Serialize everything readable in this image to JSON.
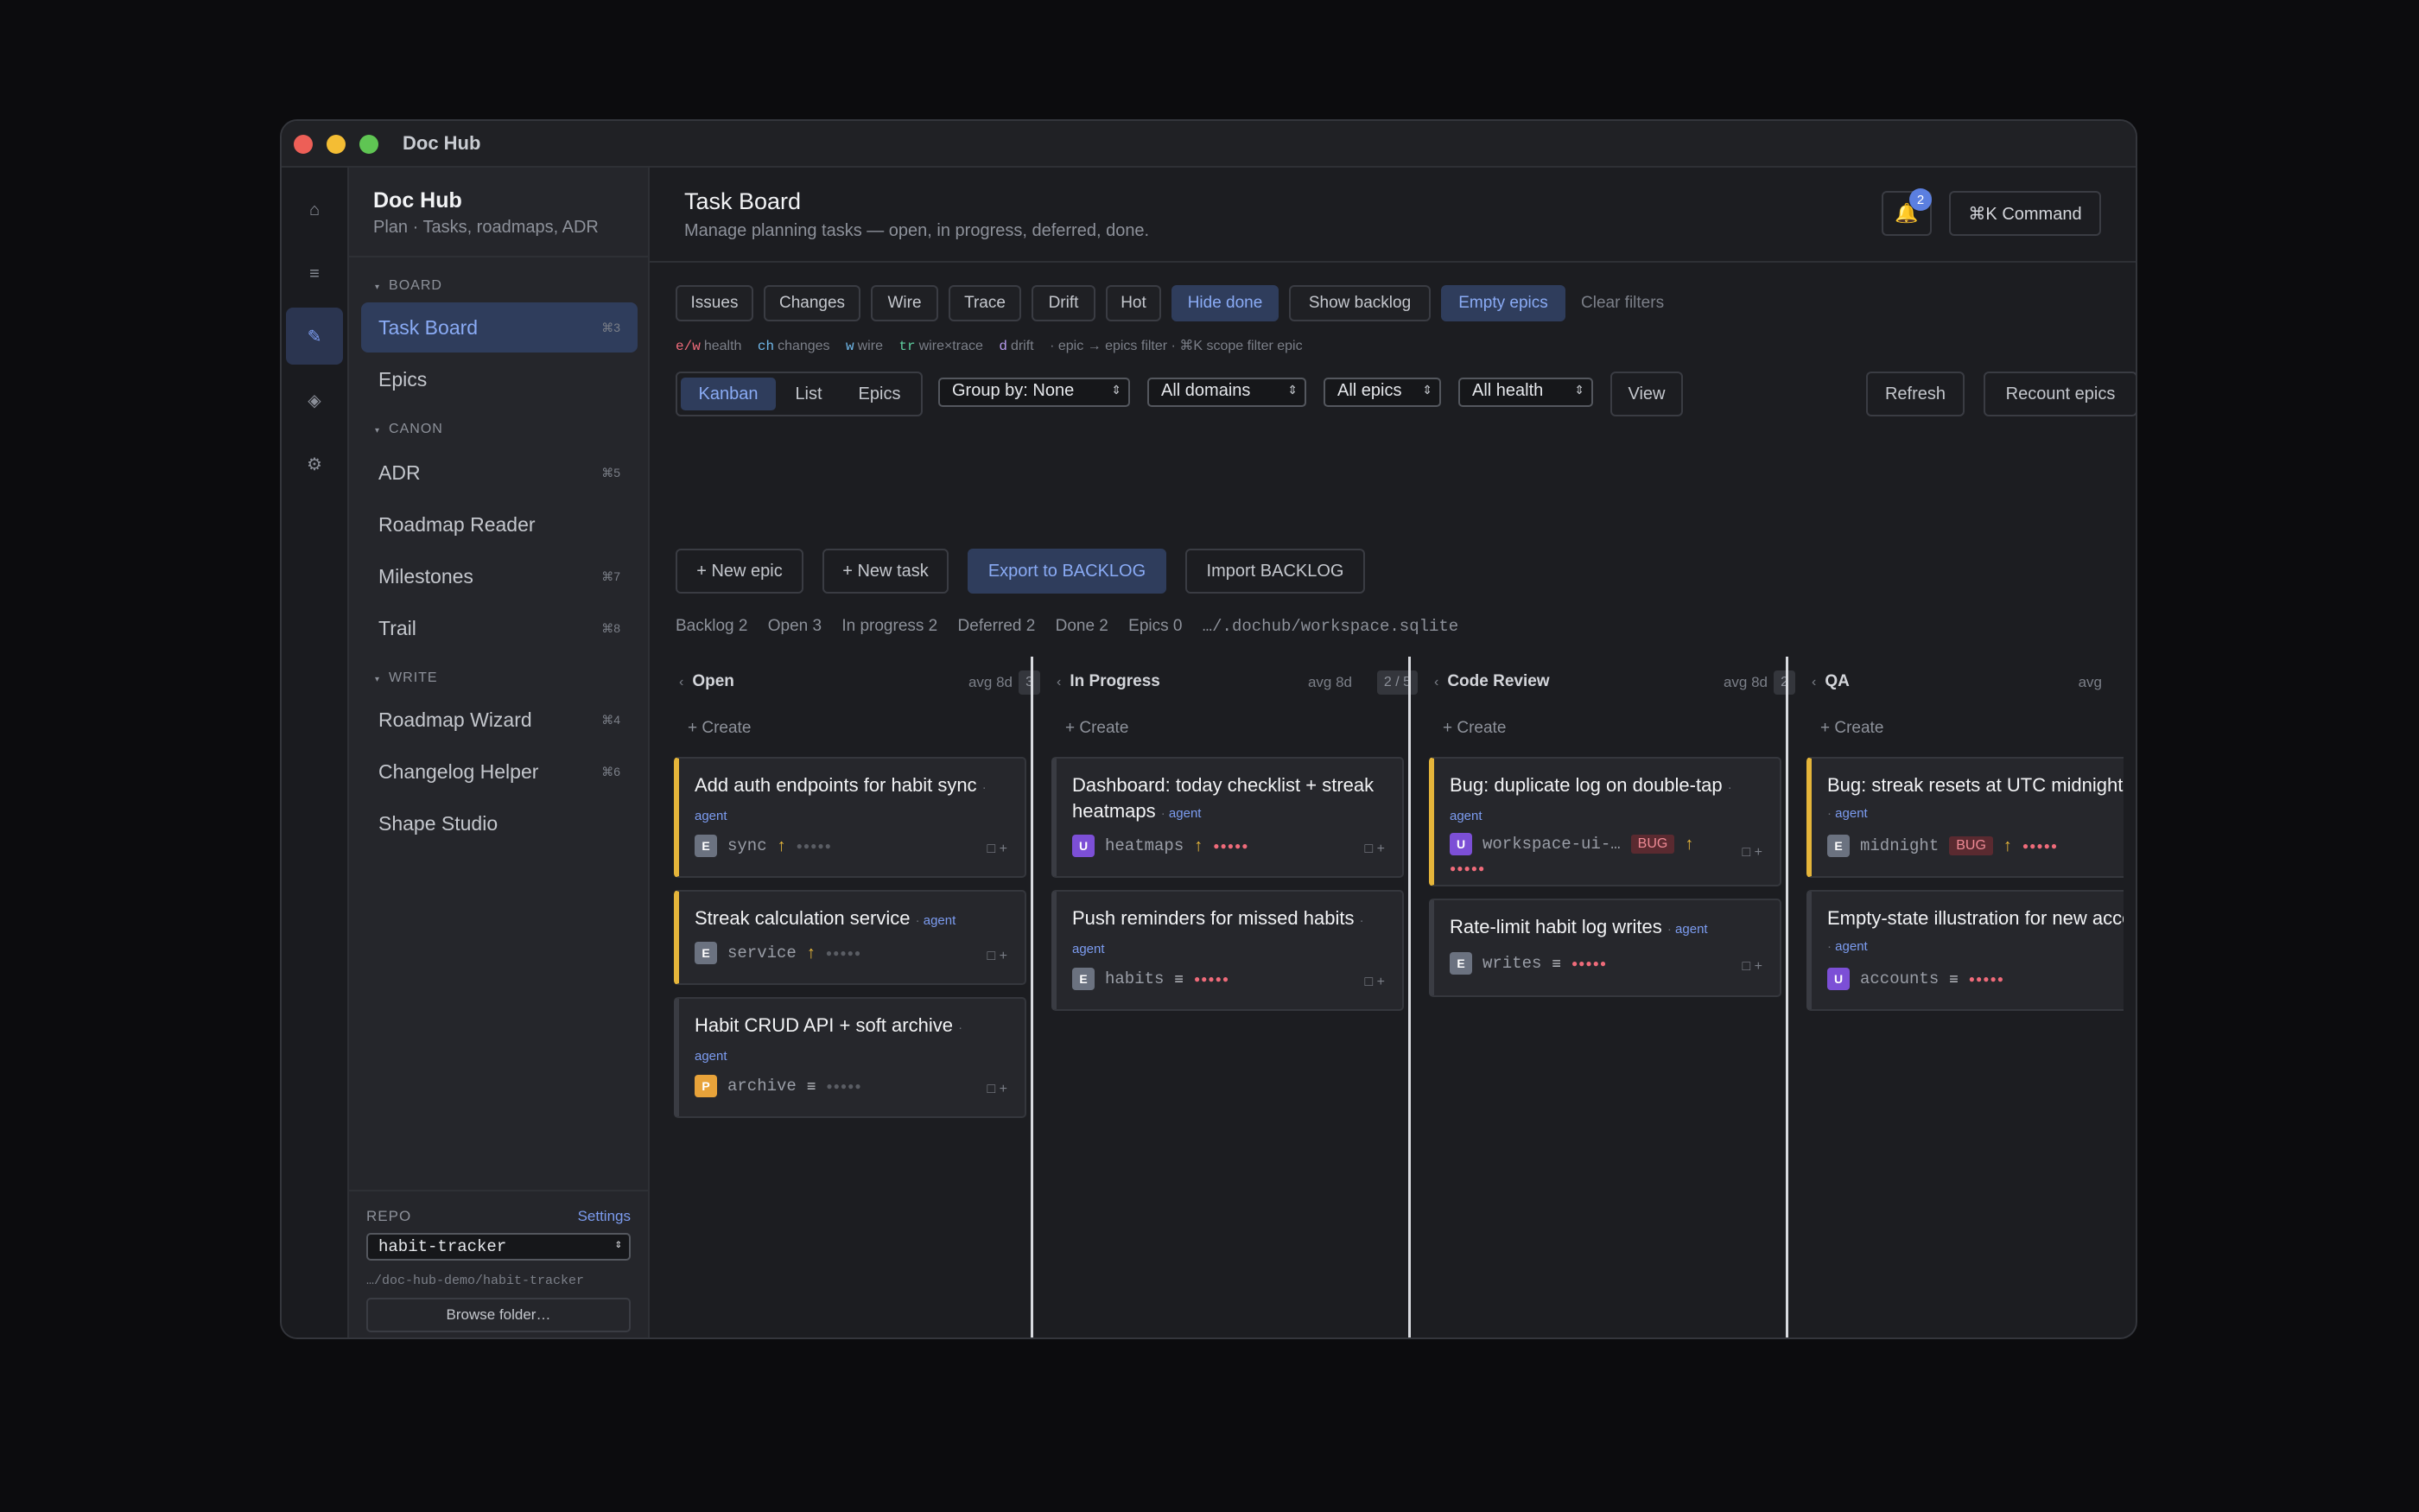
{
  "window": {
    "title": "Doc Hub"
  },
  "rail": {
    "icons": [
      "home-icon",
      "list-icon",
      "pencil-icon",
      "diamond-icon",
      "gear-icon"
    ]
  },
  "sidebar": {
    "title": "Doc Hub",
    "subtitle": "Plan · Tasks, roadmaps, ADR",
    "sections": {
      "board": "BOARD",
      "canon": "CANON",
      "write": "WRITE"
    },
    "items": [
      {
        "label": "Task Board",
        "kbd": "⌘3"
      },
      {
        "label": "Epics",
        "kbd": ""
      },
      {
        "label": "ADR",
        "kbd": "⌘5"
      },
      {
        "label": "Roadmap Reader",
        "kbd": ""
      },
      {
        "label": "Milestones",
        "kbd": "⌘7"
      },
      {
        "label": "Trail",
        "kbd": "⌘8"
      },
      {
        "label": "Roadmap Wizard",
        "kbd": "⌘4"
      },
      {
        "label": "Changelog Helper",
        "kbd": "⌘6"
      },
      {
        "label": "Shape Studio",
        "kbd": ""
      }
    ],
    "repo": {
      "label": "REPO",
      "settings": "Settings",
      "value": "habit-tracker",
      "path": "…/doc-hub-demo/habit-tracker",
      "browse": "Browse folder…"
    }
  },
  "header": {
    "title": "Task Board",
    "subtitle": "Manage planning tasks — open, in progress, deferred, done.",
    "bell_count": "2",
    "command": "⌘K Command"
  },
  "filters": {
    "chips": [
      "Issues",
      "Changes",
      "Wire",
      "Trace",
      "Drift",
      "Hot",
      "Hide done",
      "Show backlog",
      "Empty epics"
    ],
    "clear": "Clear filters"
  },
  "hints": {
    "health_key": "e/w",
    "health": "health",
    "changes_key": "ch",
    "changes": "changes",
    "wire_key": "w",
    "wire": "wire",
    "trace_key": "tr",
    "trace": "wire×trace",
    "drift_key": "d",
    "drift": "drift",
    "tail": "· epic → epics filter · ⌘K scope filter epic"
  },
  "view_tabs": [
    "Kanban",
    "List",
    "Epics"
  ],
  "selects": {
    "group": "Group by: None",
    "domains": "All domains",
    "epics": "All epics",
    "health": "All health"
  },
  "buttons": {
    "view": "View",
    "refresh": "Refresh",
    "recount": "Recount epics",
    "new_epic": "+ New epic",
    "new_task": "+ New task",
    "export": "Export to BACKLOG",
    "import": "Import BACKLOG"
  },
  "stats": {
    "backlog": "Backlog 2",
    "open": "Open 3",
    "in_progress": "In progress 2",
    "deferred": "Deferred 2",
    "done": "Done 2",
    "epics": "Epics 0",
    "db_path": "…/.dochub/workspace.sqlite"
  },
  "columns": [
    {
      "name": "Open",
      "avg": "avg 8d",
      "count": "3",
      "create": "+ Create",
      "cards": [
        {
          "title": "Add auth endpoints for habit sync",
          "tag": "agent",
          "avatar": "E",
          "domain": "sync",
          "prio": "↑",
          "bug": ""
        },
        {
          "title": "Streak calculation service",
          "tag": "agent",
          "avatar": "E",
          "domain": "service",
          "prio": "↑",
          "bug": ""
        },
        {
          "title": "Habit CRUD API + soft archive",
          "tag": "agent",
          "avatar": "P",
          "domain": "archive",
          "prio": "≡",
          "bug": ""
        }
      ]
    },
    {
      "name": "In Progress",
      "avg": "avg 8d",
      "count": "2 / 5",
      "create": "+ Create",
      "cards": [
        {
          "title": "Dashboard: today checklist + streak heatmaps",
          "tag": "agent",
          "avatar": "U",
          "domain": "heatmaps",
          "prio": "↑",
          "bug": ""
        },
        {
          "title": "Push reminders for missed habits",
          "tag": "agent",
          "avatar": "E",
          "domain": "habits",
          "prio": "≡",
          "bug": ""
        }
      ]
    },
    {
      "name": "Code Review",
      "avg": "avg 8d",
      "count": "2",
      "create": "+ Create",
      "cards": [
        {
          "title": "Bug: duplicate log on double-tap",
          "tag": "agent",
          "avatar": "U",
          "domain": "workspace-ui-…",
          "prio": "↑",
          "bug": "BUG"
        },
        {
          "title": "Rate-limit habit log writes",
          "tag": "agent",
          "avatar": "E",
          "domain": "writes",
          "prio": "≡",
          "bug": ""
        }
      ]
    },
    {
      "name": "QA",
      "avg": "avg",
      "count": "",
      "create": "+ Create",
      "cards": [
        {
          "title": "Bug: streak resets at UTC midnight",
          "tag": "agent",
          "avatar": "E",
          "domain": "midnight",
          "prio": "↑",
          "bug": "BUG"
        },
        {
          "title": "Empty-state illustration for new accounts",
          "tag": "agent",
          "avatar": "U",
          "domain": "accounts",
          "prio": "≡",
          "bug": ""
        }
      ]
    }
  ],
  "card_actions": "□ +",
  "dots": "●●●●●",
  "colors": {
    "accent": "#7c9cf0",
    "amber": "#e5b53a",
    "hot": "#ef6b7a",
    "avatar_e": "#6b7280",
    "avatar_u": "#7c4fd6",
    "avatar_p": "#e8a33a"
  }
}
